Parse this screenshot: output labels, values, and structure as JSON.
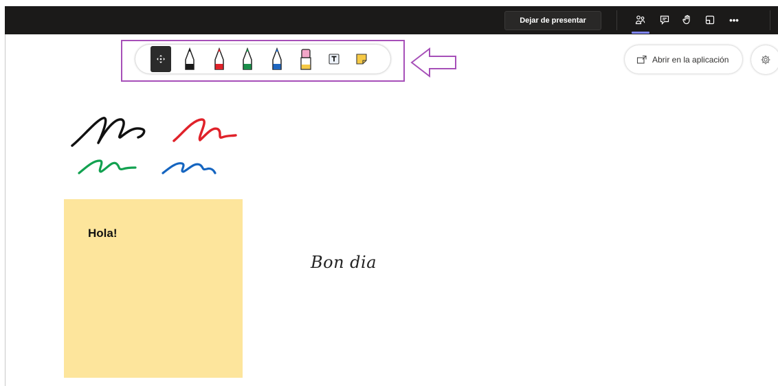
{
  "topbar": {
    "stop_presenting_label": "Dejar de presentar",
    "icons": [
      "people-icon",
      "chat-icon",
      "raise-hand-icon",
      "rooms-icon",
      "more-icon"
    ],
    "more_label": "•••",
    "active_underline_color": "#7f85f5"
  },
  "whiteboard_toolbar": {
    "tools": [
      {
        "name": "move-tool",
        "color": "#ffffff",
        "selected": true
      },
      {
        "name": "pen-black",
        "color": "#1a1a1a"
      },
      {
        "name": "pen-red",
        "color": "#e0222a"
      },
      {
        "name": "pen-green",
        "color": "#1a8f4a"
      },
      {
        "name": "pen-blue",
        "color": "#1e66c0"
      },
      {
        "name": "highlighter-pink",
        "color": "#f2a6c8"
      },
      {
        "name": "text-tool",
        "color": "#1a1a1a"
      },
      {
        "name": "sticky-note-tool",
        "color": "#f6c945"
      }
    ],
    "highlight_color": "#a64fb8"
  },
  "open_in_app": {
    "label": "Abrir en la aplicación",
    "icon": "open-external-icon"
  },
  "settings": {
    "icon": "gear-icon"
  },
  "canvas": {
    "stroke_colors": [
      "#111111",
      "#e0222a",
      "#12a150",
      "#1565c0"
    ],
    "sticky_note": {
      "text": "Hola!",
      "color": "#fde59c"
    },
    "text_item": "Bon dia"
  }
}
